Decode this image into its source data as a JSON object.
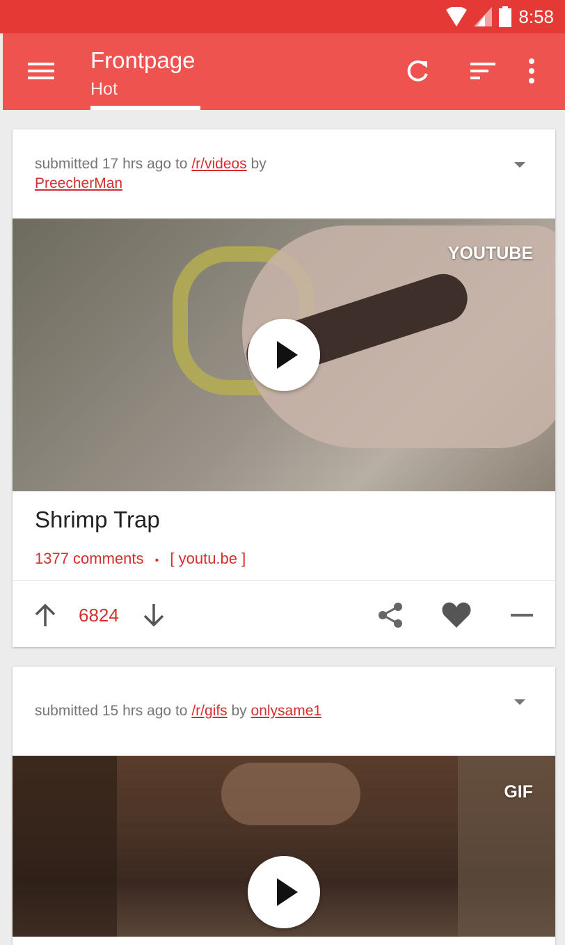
{
  "status_bar": {
    "time": "8:58"
  },
  "toolbar": {
    "title": "Frontpage",
    "subtitle": "Hot"
  },
  "posts": [
    {
      "meta_prefix": "submitted 17 hrs ago to ",
      "subreddit": "/r/videos",
      "by": " by",
      "author": "PreecherMan",
      "badge": "YOUTUBE",
      "title": "Shrimp Trap",
      "comments": "1377 comments",
      "separator": "•",
      "domain": "[ youtu.be ]",
      "score": "6824"
    },
    {
      "meta_prefix": "submitted 15 hrs ago to ",
      "subreddit": "/r/gifs",
      "by": " by ",
      "author": "onlysame1",
      "badge": "GIF"
    }
  ],
  "colors": {
    "status": "#e53935",
    "toolbar": "#ef5350",
    "accent": "#d32f2f"
  }
}
